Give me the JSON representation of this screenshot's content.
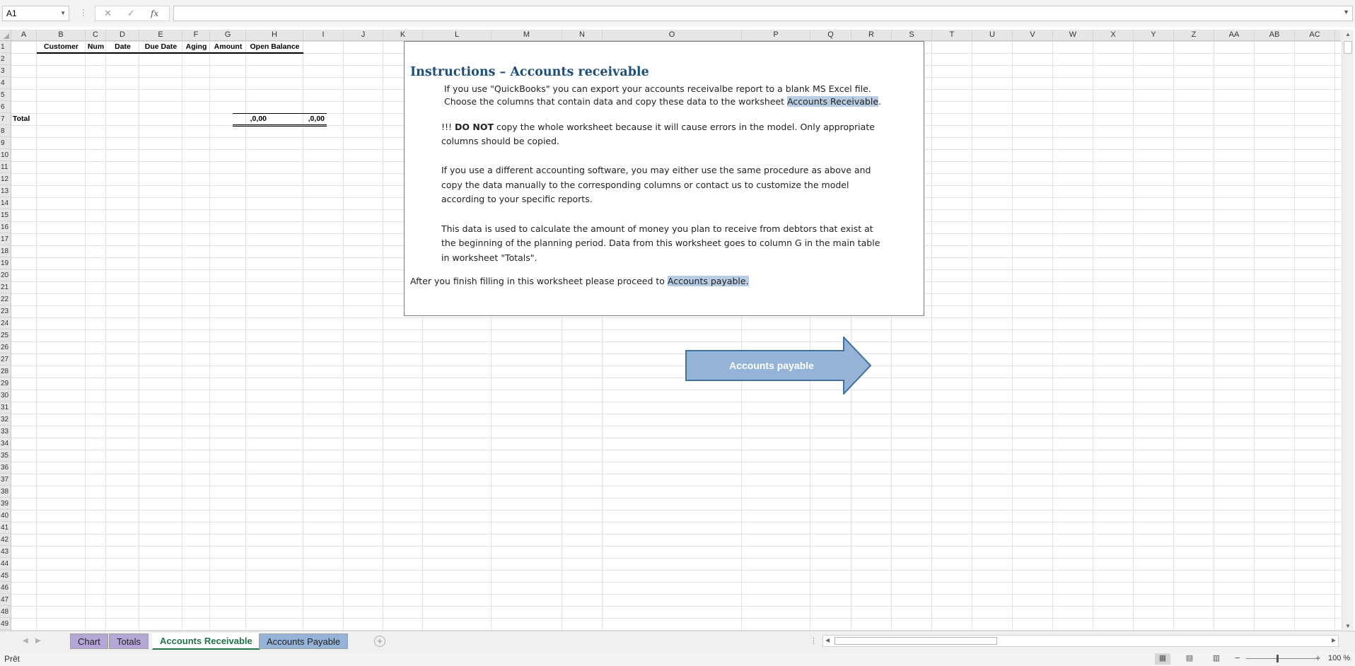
{
  "formula_bar": {
    "name_box": "A1",
    "cancel_icon": "✕",
    "enter_icon": "✓",
    "function_icon": "fx",
    "formula": ""
  },
  "columns": [
    "A",
    "B",
    "C",
    "D",
    "E",
    "F",
    "G",
    "H",
    "I",
    "J",
    "K",
    "L",
    "M",
    "N",
    "O",
    "P",
    "Q",
    "R",
    "S",
    "T",
    "U",
    "V",
    "W",
    "X",
    "Y",
    "Z",
    "AA",
    "AB",
    "AC"
  ],
  "rows": [
    "1",
    "2",
    "3",
    "4",
    "5",
    "6",
    "7",
    "8",
    "9",
    "10",
    "11",
    "12",
    "13",
    "14",
    "15",
    "16",
    "17",
    "18",
    "19",
    "20",
    "21",
    "22",
    "23",
    "24",
    "25",
    "26",
    "27",
    "28",
    "29",
    "30",
    "31",
    "32",
    "33",
    "34",
    "35",
    "36",
    "37",
    "38",
    "39",
    "40",
    "41",
    "42",
    "43",
    "44",
    "45",
    "46",
    "47",
    "48",
    "49"
  ],
  "table": {
    "headers": [
      "Customer",
      "Num",
      "Date",
      "Due Date",
      "Aging",
      "Amount",
      "Open Balance"
    ],
    "total_label": "Total",
    "total_amount": ",0,00",
    "total_open_balance": ",0,00"
  },
  "instructions": {
    "title": "Instructions – Accounts receivable",
    "p1_line1": "If you use \"QuickBooks\" you can export your accounts receivalbe report to a blank MS Excel file.",
    "p1_line2_pre": "Choose the columns that contain data and copy these data to the worksheet ",
    "p1_line2_link": "Accounts Receivable",
    "p1_line2_post": ".",
    "p2_prefix": "!!! ",
    "p2_bold": "DO NOT",
    "p2_line1_rest": " copy the whole worksheet because it will cause errors in the model. Only appropriate",
    "p2_line2": "columns should be copied.",
    "p3_line1": "If you use a different accounting software, you may either use the same procedure as above and",
    "p3_line2": "copy the data manually to the corresponding columns or contact us to customize the model",
    "p3_line3": "according to your specific reports.",
    "p4_line1": "This data is used to calculate the amount of money  you plan to receive from debtors that exist at",
    "p4_line2": "the beginning of the planning period. Data from this worksheet goes to column G in the main table",
    "p4_line3": "in worksheet \"Totals\".",
    "p5_pre": "After you finish filling in this worksheet please proceed to ",
    "p5_link": "Accounts payable."
  },
  "arrow_button": {
    "label": "Accounts payable",
    "color": "#95b3d7",
    "border": "#41719c"
  },
  "sheet_tabs": [
    {
      "label": "Chart",
      "color": "#b4a7d6",
      "active": false
    },
    {
      "label": "Totals",
      "color": "#b4a7d6",
      "active": false
    },
    {
      "label": "Accounts Receivable",
      "color": "#ffffff",
      "active": true
    },
    {
      "label": "Accounts Payable",
      "color": "#95b3d7",
      "active": false
    }
  ],
  "status_bar": {
    "status": "Prêt",
    "zoom": "100 %"
  },
  "colors": {
    "accent_green": "#217346",
    "title_blue": "#1f4e79",
    "highlight": "#b8cce4"
  }
}
